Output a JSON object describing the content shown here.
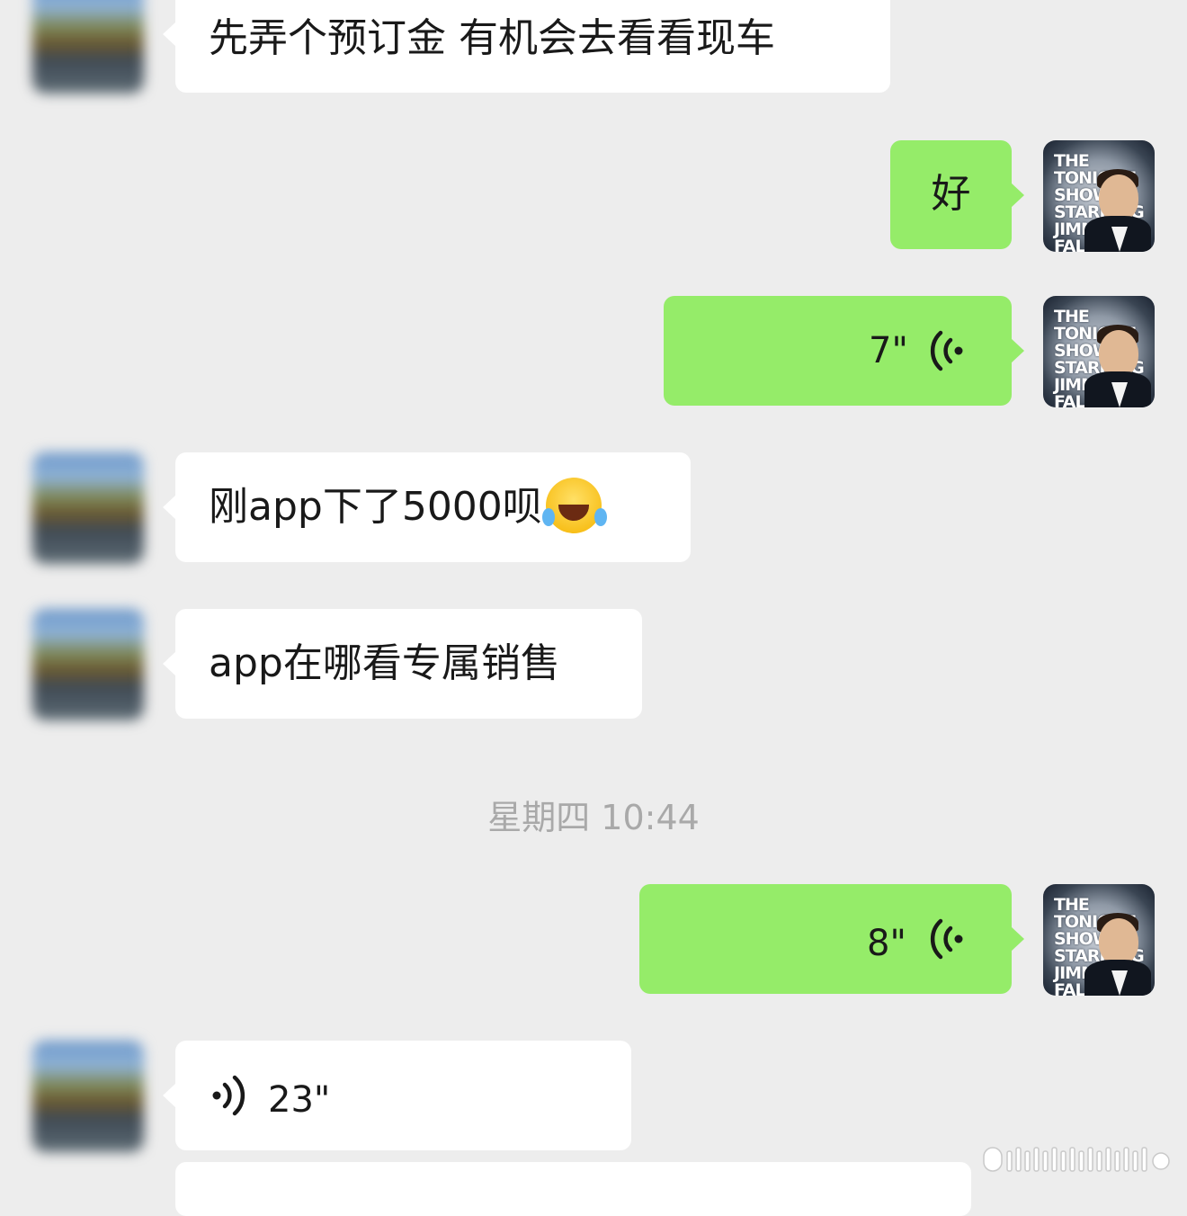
{
  "messages": [
    {
      "id": "m1",
      "side": "in",
      "type": "text",
      "text": "先弄个预订金 有机会去看看现车"
    },
    {
      "id": "m2",
      "side": "out",
      "type": "text",
      "text": "好"
    },
    {
      "id": "m3",
      "side": "out",
      "type": "voice",
      "duration": "7\""
    },
    {
      "id": "m4",
      "side": "in",
      "type": "text",
      "text": "刚app下了5000呗",
      "emoji": "face-with-tears-of-joy"
    },
    {
      "id": "m5",
      "side": "in",
      "type": "text",
      "text": "app在哪看专属销售"
    },
    {
      "id": "m6",
      "side": "out",
      "type": "voice",
      "duration": "8\""
    },
    {
      "id": "m7",
      "side": "in",
      "type": "voice",
      "duration": "23\""
    }
  ],
  "timestamp": "星期四 10:44",
  "self_avatar": {
    "label": "THE TONIGHT SHOW STARRING JIMMY FALLON"
  },
  "colors": {
    "background": "#ededed",
    "incoming_bubble": "#ffffff",
    "outgoing_bubble": "#95ec69",
    "timestamp_text": "#a9a9a9"
  },
  "icons": {
    "voice_outgoing": "voice-wave-left-icon",
    "voice_incoming": "voice-wave-right-icon",
    "watermark": "weibo-watermark-icon"
  }
}
